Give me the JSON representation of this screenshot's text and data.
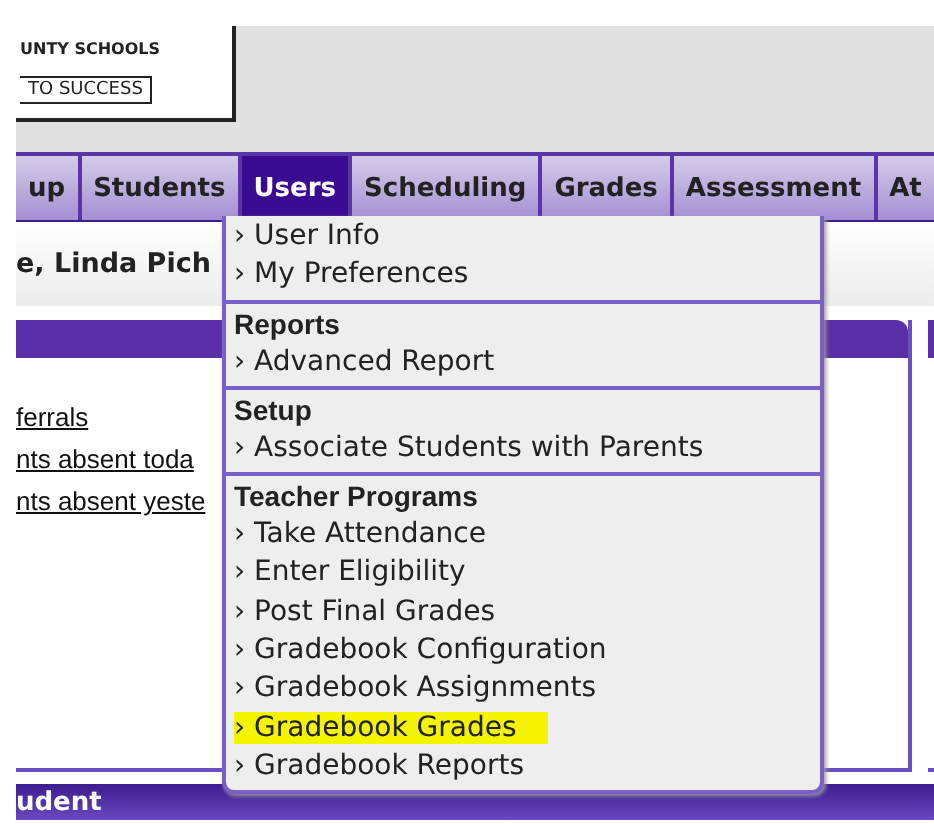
{
  "logo": {
    "line_1": "UNTY SCHOOLS",
    "line_2": "TO SUCCESS"
  },
  "nav": {
    "tabs": [
      {
        "label": "up",
        "selected": false
      },
      {
        "label": "Students",
        "selected": false
      },
      {
        "label": "Users",
        "selected": true
      },
      {
        "label": "Scheduling",
        "selected": false
      },
      {
        "label": "Grades",
        "selected": false
      },
      {
        "label": "Assessment",
        "selected": false
      },
      {
        "label": "At",
        "selected": false
      }
    ]
  },
  "greeting": "e, Linda Pich",
  "left_panel": {
    "links": [
      "ferrals",
      "nts absent toda",
      "nts absent yeste"
    ]
  },
  "users_menu": {
    "groups": [
      {
        "items": [
          {
            "label": "› User Info",
            "highlighted": false
          },
          {
            "label": "› My Preferences",
            "highlighted": false
          }
        ]
      },
      {
        "heading": "Reports",
        "items": [
          {
            "label": "› Advanced Report",
            "highlighted": false
          }
        ]
      },
      {
        "heading": "Setup",
        "items": [
          {
            "label": "› Associate Students with Parents",
            "highlighted": false
          }
        ]
      },
      {
        "heading": "Teacher Programs",
        "items": [
          {
            "label": "› Take Attendance",
            "highlighted": false
          },
          {
            "label": "› Enter Eligibility",
            "highlighted": false
          },
          {
            "label": "› Post Final Grades",
            "highlighted": false
          },
          {
            "label": "› Gradebook Configuration",
            "highlighted": false
          },
          {
            "label": "› Gradebook Assignments",
            "highlighted": false
          },
          {
            "label": "› Gradebook Grades",
            "highlighted": true
          },
          {
            "label": "› Gradebook Reports",
            "highlighted": false
          }
        ]
      }
    ]
  },
  "bottom_bar": {
    "title": "udent"
  }
}
